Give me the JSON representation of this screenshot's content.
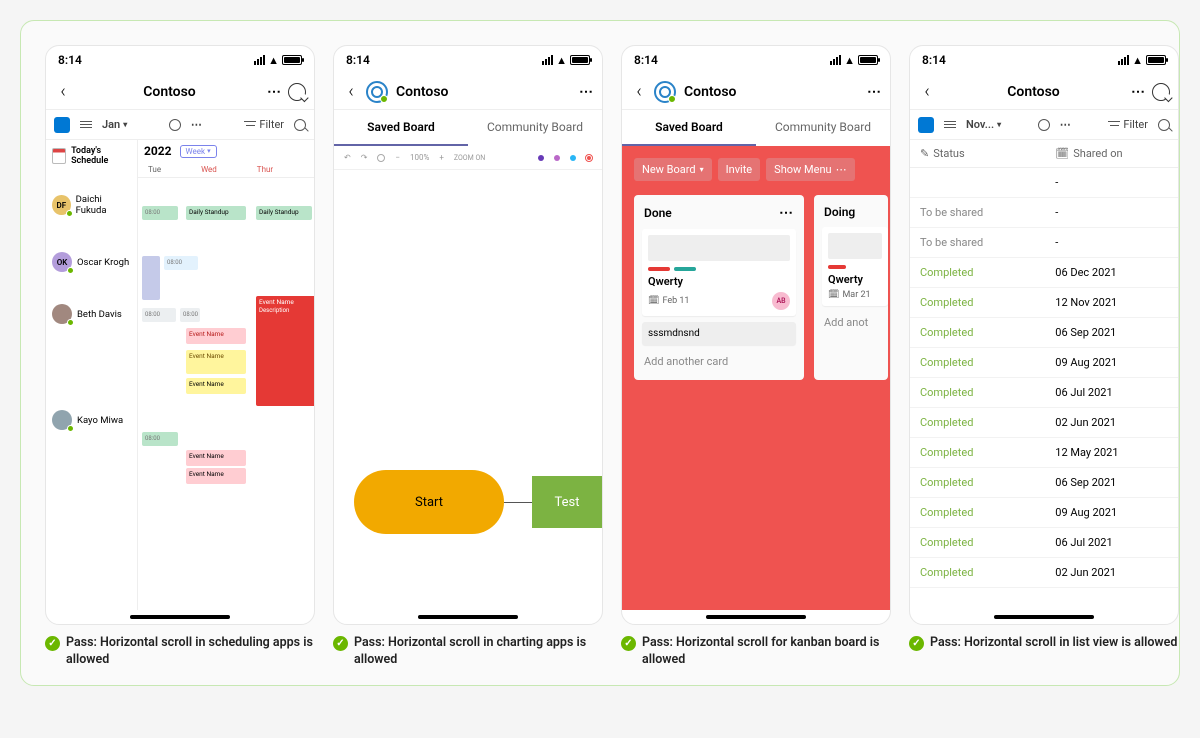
{
  "status_time": "8:14",
  "app_title": "Contoso",
  "filter_label": "Filter",
  "phone1": {
    "month_dd": "Jan",
    "todays_schedule": "Today's Schedule",
    "year": "2022",
    "week_label": "Week",
    "days": {
      "tue": "Tue",
      "wed": "Wed",
      "thur": "Thur"
    },
    "people": [
      {
        "initials": "DF",
        "name": "Daichi Fukuda",
        "color": "#e8c36a"
      },
      {
        "initials": "OK",
        "name": "Oscar Krogh",
        "color": "#b39ddb"
      },
      {
        "initials": "",
        "name": "Beth Davis",
        "color": "#a1887f"
      },
      {
        "initials": "",
        "name": "Kayo Miwa",
        "color": "#90a4ae"
      }
    ],
    "event_labels": {
      "daily_standup": "Daily Standup",
      "event_name": "Event Name",
      "description": "Description"
    },
    "caption": "Pass: Horizontal scroll in scheduling apps is allowed"
  },
  "phone2": {
    "tab_saved": "Saved Board",
    "tab_community": "Community Board",
    "zoom_pct": "100%",
    "zoom_on": "ZOOM ON",
    "start_label": "Start",
    "test_label": "Test",
    "caption": "Pass: Horizontal scroll in charting apps is allowed"
  },
  "phone3": {
    "tab_saved": "Saved Board",
    "tab_community": "Community Board",
    "btn_new": "New Board",
    "btn_invite": "Invite",
    "btn_menu": "Show Menu",
    "col_done": "Done",
    "col_doing": "Doing",
    "card1": {
      "title": "Qwerty",
      "date": "Feb 11",
      "avatar": "AB"
    },
    "card_plain": "sssmdnsnd",
    "card2": {
      "title": "Qwerty",
      "date": "Mar 21"
    },
    "add_card": "Add another card",
    "add_card_partial": "Add anot",
    "caption": "Pass: Horizontal scroll for kanban board is allowed"
  },
  "phone4": {
    "month_dd": "Nov...",
    "col_status": "Status",
    "col_shared": "Shared on",
    "rows": [
      {
        "status": "",
        "date": "-",
        "cls": ""
      },
      {
        "status": "To be shared",
        "date": "-",
        "cls": "st-tobe"
      },
      {
        "status": "To be shared",
        "date": "-",
        "cls": "st-tobe"
      },
      {
        "status": "Completed",
        "date": "06 Dec 2021",
        "cls": "st-completed"
      },
      {
        "status": "Completed",
        "date": "12 Nov 2021",
        "cls": "st-completed"
      },
      {
        "status": "Completed",
        "date": "06 Sep 2021",
        "cls": "st-completed"
      },
      {
        "status": "Completed",
        "date": "09 Aug 2021",
        "cls": "st-completed"
      },
      {
        "status": "Completed",
        "date": "06 Jul 2021",
        "cls": "st-completed"
      },
      {
        "status": "Completed",
        "date": "02 Jun 2021",
        "cls": "st-completed"
      },
      {
        "status": "Completed",
        "date": "12 May 2021",
        "cls": "st-completed"
      },
      {
        "status": "Completed",
        "date": "06 Sep 2021",
        "cls": "st-completed"
      },
      {
        "status": "Completed",
        "date": "09 Aug 2021",
        "cls": "st-completed"
      },
      {
        "status": "Completed",
        "date": "06 Jul 2021",
        "cls": "st-completed"
      },
      {
        "status": "Completed",
        "date": "02 Jun 2021",
        "cls": "st-completed"
      }
    ],
    "caption": "Pass: Horizontal scroll in list view is allowed"
  }
}
